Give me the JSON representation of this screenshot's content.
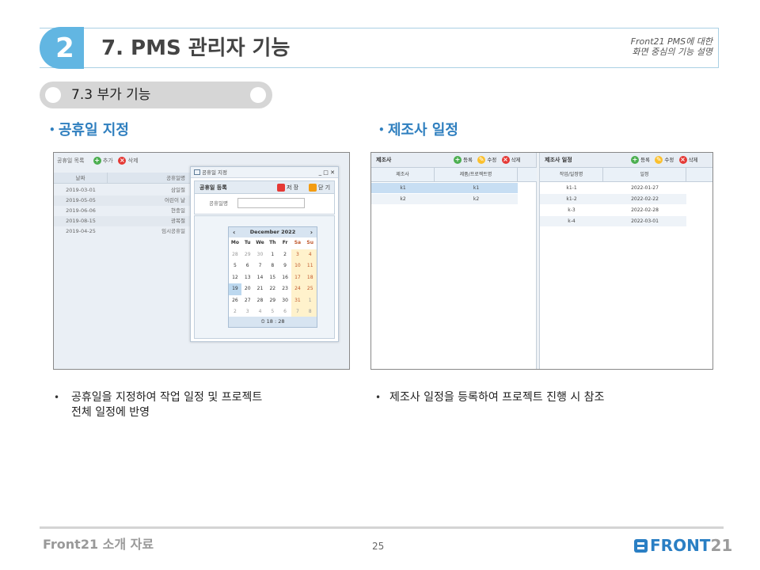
{
  "header": {
    "number": "2",
    "title": "7. PMS 관리자 기능",
    "note_line1": "Front21 PMS에 대한",
    "note_line2": "화면 중심의 기능 설명"
  },
  "subsection": {
    "label": "7.3 부가 기능"
  },
  "left_section": {
    "title": "공휴일 지정",
    "bullet_line1": "공휴일을 지정하여 작업 일정 및 프로젝트",
    "bullet_line2": "전체 일정에 반영",
    "list": {
      "title": "공휴일 목록",
      "add": "추가",
      "delete": "삭제",
      "col_date": "날짜",
      "col_name": "공휴일명",
      "rows": [
        {
          "date": "2019-03-01",
          "name": "삼일절"
        },
        {
          "date": "2019-05-05",
          "name": "어린이 날"
        },
        {
          "date": "2019-06-06",
          "name": "현충일"
        },
        {
          "date": "2019-08-15",
          "name": "광복절"
        },
        {
          "date": "2019-04-25",
          "name": "임시공휴일"
        }
      ]
    },
    "dialog": {
      "window_title": "공휴일 지정",
      "controls": "_ □ ✕",
      "panel_title": "공휴일 등록",
      "save": "저 장",
      "close": "닫 기",
      "field_label": "공휴일명",
      "field_value": "",
      "calendar": {
        "month": "December 2022",
        "prev": "‹",
        "next": "›",
        "dow": [
          "Mo",
          "Tu",
          "We",
          "Th",
          "Fr",
          "Sa",
          "Su"
        ],
        "weeks": [
          [
            "28",
            "29",
            "30",
            "1",
            "2",
            "3",
            "4"
          ],
          [
            "5",
            "6",
            "7",
            "8",
            "9",
            "10",
            "11"
          ],
          [
            "12",
            "13",
            "14",
            "15",
            "16",
            "17",
            "18"
          ],
          [
            "19",
            "20",
            "21",
            "22",
            "23",
            "24",
            "25"
          ],
          [
            "26",
            "27",
            "28",
            "29",
            "30",
            "31",
            "1"
          ],
          [
            "2",
            "3",
            "4",
            "5",
            "6",
            "7",
            "8"
          ]
        ],
        "time": "18 : 28"
      }
    }
  },
  "right_section": {
    "title": "제조사 일정",
    "bullet_line1": "제조사 일정을 등록하여 프로젝트 진행 시 참조",
    "left_pane": {
      "title": "제조사",
      "register": "등록",
      "edit": "수정",
      "delete": "삭제",
      "col1": "제조사",
      "col2": "제품/프로젝트명",
      "rows": [
        [
          "k1",
          "k1"
        ],
        [
          "k2",
          "k2"
        ]
      ]
    },
    "right_pane": {
      "title": "제조사 일정",
      "register": "등록",
      "edit": "수정",
      "delete": "삭제",
      "col1": "작업/일정명",
      "col2": "일정",
      "rows": [
        [
          "k1-1",
          "2022-01-27"
        ],
        [
          "k1-2",
          "2022-02-22"
        ],
        [
          "k-3",
          "2022-02-28"
        ],
        [
          "k-4",
          "2022-03-01"
        ]
      ]
    }
  },
  "footer": {
    "left": "Front21 소개 자료",
    "page": "25",
    "logo_main": "FRONT",
    "logo_num": "21"
  },
  "colors": {
    "accent": "#62b6e2",
    "section_title": "#2f7fbf",
    "logo": "#2a7fc4"
  }
}
